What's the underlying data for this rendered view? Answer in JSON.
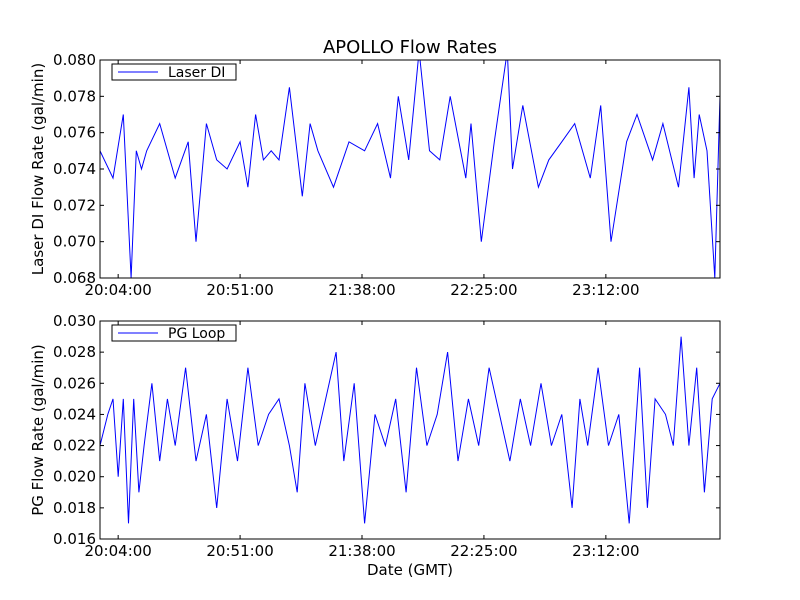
{
  "chart_data": [
    {
      "type": "line",
      "title": "APOLLO Flow Rates",
      "xlabel": "",
      "ylabel": "Laser DI Flow Rate (gal/min)",
      "x_ticks": [
        "20:04:00",
        "20:51:00",
        "21:38:00",
        "22:25:00",
        "23:12:00"
      ],
      "y_ticks": [
        "0.068",
        "0.070",
        "0.072",
        "0.074",
        "0.076",
        "0.078",
        "0.080"
      ],
      "ylim": [
        0.068,
        0.08
      ],
      "xlim": [
        "19:57:00",
        "23:56:00"
      ],
      "legend": {
        "placement": "top-left"
      },
      "grid": false,
      "color": "#0000ff",
      "series": [
        {
          "name": "Laser DI",
          "x": [
            "19:57:00",
            "20:02:00",
            "20:06:00",
            "20:09:00",
            "20:11:00",
            "20:13:00",
            "20:15:00",
            "20:20:00",
            "20:26:00",
            "20:31:00",
            "20:34:00",
            "20:38:00",
            "20:42:00",
            "20:46:00",
            "20:51:00",
            "20:54:00",
            "20:57:00",
            "21:00:00",
            "21:03:00",
            "21:06:00",
            "21:10:00",
            "21:15:00",
            "21:18:00",
            "21:21:00",
            "21:27:00",
            "21:33:00",
            "21:39:00",
            "21:44:00",
            "21:49:00",
            "21:52:00",
            "21:56:00",
            "22:00:00",
            "22:04:00",
            "22:08:00",
            "22:12:00",
            "22:18:00",
            "22:20:00",
            "22:24:00",
            "22:29:00",
            "22:34:00",
            "22:36:00",
            "22:40:00",
            "22:46:00",
            "22:50:00",
            "22:55:00",
            "23:00:00",
            "23:06:00",
            "23:10:00",
            "23:14:00",
            "23:20:00",
            "23:24:00",
            "23:30:00",
            "23:34:00",
            "23:40:00",
            "23:44:00",
            "23:46:00",
            "23:48:00",
            "23:51:00",
            "23:54:00",
            "23:56:00"
          ],
          "values": [
            0.075,
            0.0735,
            0.077,
            0.068,
            0.075,
            0.074,
            0.075,
            0.0765,
            0.0735,
            0.0755,
            0.07,
            0.0765,
            0.0745,
            0.074,
            0.0755,
            0.073,
            0.077,
            0.0745,
            0.075,
            0.0745,
            0.0785,
            0.0725,
            0.0765,
            0.075,
            0.073,
            0.0755,
            0.075,
            0.0765,
            0.0735,
            0.078,
            0.0745,
            0.0805,
            0.075,
            0.0745,
            0.078,
            0.0735,
            0.0765,
            0.07,
            0.0755,
            0.0805,
            0.074,
            0.0775,
            0.073,
            0.0745,
            0.0755,
            0.0765,
            0.0735,
            0.0775,
            0.07,
            0.0755,
            0.077,
            0.0745,
            0.0765,
            0.073,
            0.0785,
            0.0735,
            0.077,
            0.075,
            0.068,
            0.078
          ]
        }
      ]
    },
    {
      "type": "line",
      "title": "",
      "xlabel": "Date (GMT)",
      "ylabel": "PG Flow Rate (gal/min)",
      "x_ticks": [
        "20:04:00",
        "20:51:00",
        "21:38:00",
        "22:25:00",
        "23:12:00"
      ],
      "y_ticks": [
        "0.016",
        "0.018",
        "0.020",
        "0.022",
        "0.024",
        "0.026",
        "0.028",
        "0.030"
      ],
      "ylim": [
        0.016,
        0.03
      ],
      "xlim": [
        "19:57:00",
        "23:56:00"
      ],
      "legend": {
        "placement": "top-left"
      },
      "grid": false,
      "color": "#0000ff",
      "series": [
        {
          "name": "PG Loop",
          "x": [
            "19:57:00",
            "20:00:00",
            "20:02:00",
            "20:04:00",
            "20:06:00",
            "20:08:00",
            "20:10:00",
            "20:12:00",
            "20:14:00",
            "20:17:00",
            "20:20:00",
            "20:23:00",
            "20:26:00",
            "20:30:00",
            "20:34:00",
            "20:38:00",
            "20:42:00",
            "20:46:00",
            "20:50:00",
            "20:54:00",
            "20:58:00",
            "21:02:00",
            "21:06:00",
            "21:10:00",
            "21:13:00",
            "21:16:00",
            "21:20:00",
            "21:24:00",
            "21:28:00",
            "21:31:00",
            "21:35:00",
            "21:39:00",
            "21:43:00",
            "21:47:00",
            "21:51:00",
            "21:55:00",
            "21:59:00",
            "22:03:00",
            "22:07:00",
            "22:11:00",
            "22:15:00",
            "22:19:00",
            "22:23:00",
            "22:27:00",
            "22:31:00",
            "22:35:00",
            "22:39:00",
            "22:43:00",
            "22:47:00",
            "22:51:00",
            "22:55:00",
            "22:59:00",
            "23:02:00",
            "23:05:00",
            "23:09:00",
            "23:13:00",
            "23:17:00",
            "23:21:00",
            "23:25:00",
            "23:28:00",
            "23:31:00",
            "23:35:00",
            "23:38:00",
            "23:41:00",
            "23:44:00",
            "23:47:00",
            "23:50:00",
            "23:53:00",
            "23:56:00"
          ],
          "values": [
            0.022,
            0.024,
            0.025,
            0.02,
            0.025,
            0.017,
            0.025,
            0.019,
            0.022,
            0.026,
            0.021,
            0.025,
            0.022,
            0.027,
            0.021,
            0.024,
            0.018,
            0.025,
            0.021,
            0.027,
            0.022,
            0.024,
            0.025,
            0.022,
            0.019,
            0.026,
            0.022,
            0.025,
            0.028,
            0.021,
            0.026,
            0.017,
            0.024,
            0.022,
            0.025,
            0.019,
            0.027,
            0.022,
            0.024,
            0.028,
            0.021,
            0.025,
            0.022,
            0.027,
            0.024,
            0.021,
            0.025,
            0.022,
            0.026,
            0.022,
            0.024,
            0.018,
            0.025,
            0.022,
            0.027,
            0.022,
            0.024,
            0.017,
            0.027,
            0.018,
            0.025,
            0.024,
            0.022,
            0.029,
            0.022,
            0.027,
            0.019,
            0.025,
            0.026
          ]
        }
      ]
    }
  ]
}
